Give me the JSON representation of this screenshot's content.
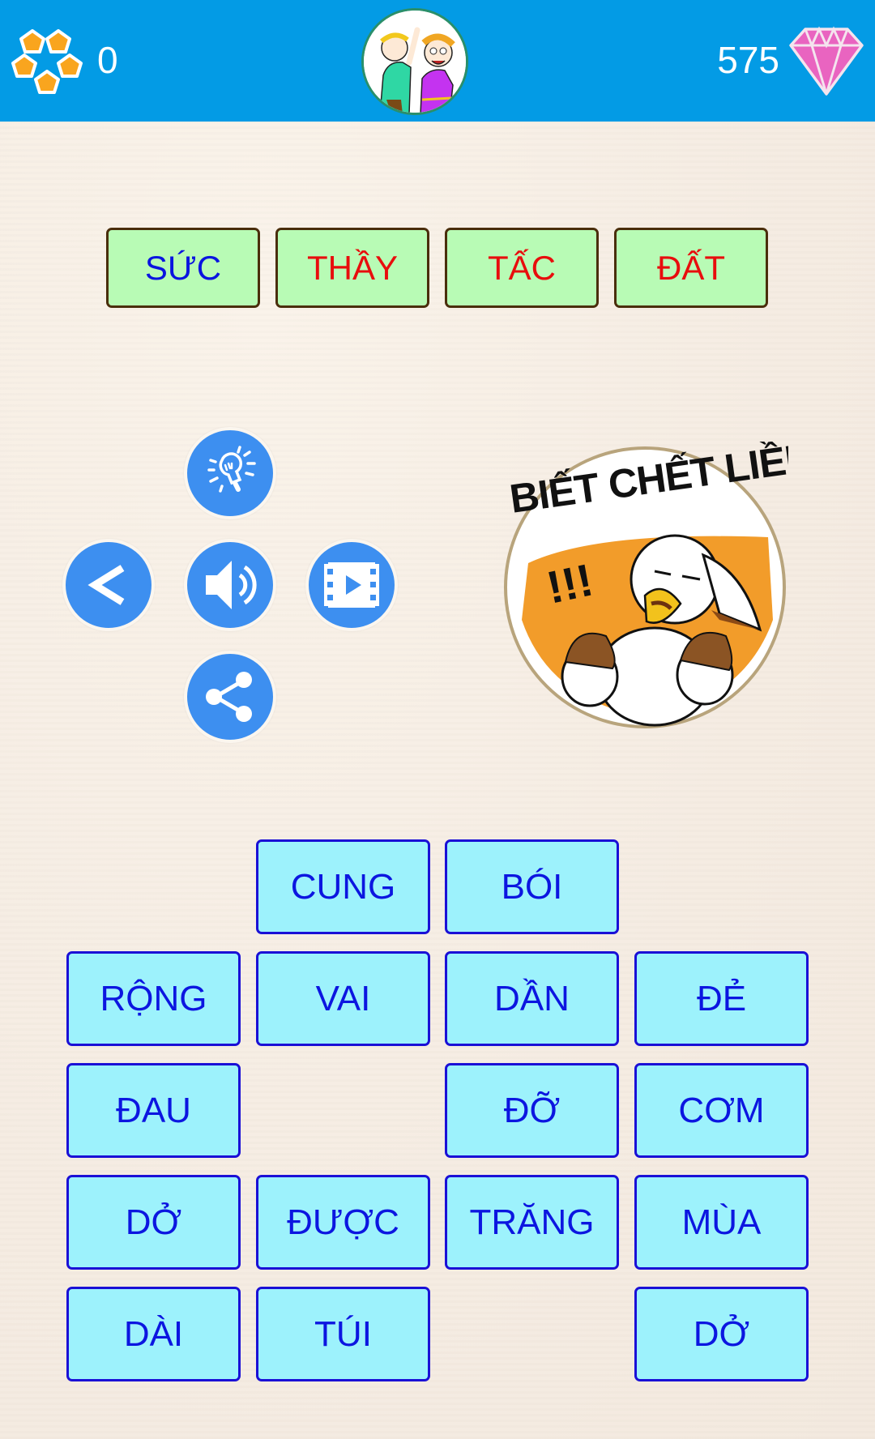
{
  "header": {
    "stars_icon": "five-pentagon-stars-icon",
    "stars_count": "0",
    "avatar": "two-cartoon-characters-logo",
    "gems_count": "575",
    "gem_icon": "pink-diamond-icon"
  },
  "answer": {
    "slots": [
      {
        "text": "SỨC",
        "color": "#0a14e0"
      },
      {
        "text": "THẦY",
        "color": "#e80d0d"
      },
      {
        "text": "TẤC",
        "color": "#e80d0d"
      },
      {
        "text": "ĐẤT",
        "color": "#e80d0d"
      }
    ]
  },
  "controls": {
    "hint": "lightbulb-icon",
    "back": "chevron-left-icon",
    "sound": "speaker-icon",
    "video": "film-play-icon",
    "share": "share-icon"
  },
  "sticker": {
    "text_line": "BIẾT CHẾT LIỀN",
    "exclaim": "!!!"
  },
  "tiles": [
    {
      "row": 0,
      "col": 1,
      "text": "CUNG"
    },
    {
      "row": 0,
      "col": 2,
      "text": "BÓI"
    },
    {
      "row": 1,
      "col": 0,
      "text": "RỘNG"
    },
    {
      "row": 1,
      "col": 1,
      "text": "VAI"
    },
    {
      "row": 1,
      "col": 2,
      "text": "DẦN"
    },
    {
      "row": 1,
      "col": 3,
      "text": "ĐẺ"
    },
    {
      "row": 2,
      "col": 0,
      "text": "ĐAU"
    },
    {
      "row": 2,
      "col": 2,
      "text": "ĐỠ"
    },
    {
      "row": 2,
      "col": 3,
      "text": "CƠM"
    },
    {
      "row": 3,
      "col": 0,
      "text": "DỞ"
    },
    {
      "row": 3,
      "col": 1,
      "text": "ĐƯỢC"
    },
    {
      "row": 3,
      "col": 2,
      "text": "TRĂNG"
    },
    {
      "row": 3,
      "col": 3,
      "text": "MÙA"
    },
    {
      "row": 4,
      "col": 0,
      "text": "DÀI"
    },
    {
      "row": 4,
      "col": 1,
      "text": "TÚI"
    },
    {
      "row": 4,
      "col": 3,
      "text": "DỞ"
    }
  ],
  "colors": {
    "header_bg": "#039be5",
    "slot_bg": "#b8fbb5",
    "tile_bg": "#9df2fc",
    "tile_text": "#0c16e0",
    "button_blue": "#3d8ff0"
  }
}
